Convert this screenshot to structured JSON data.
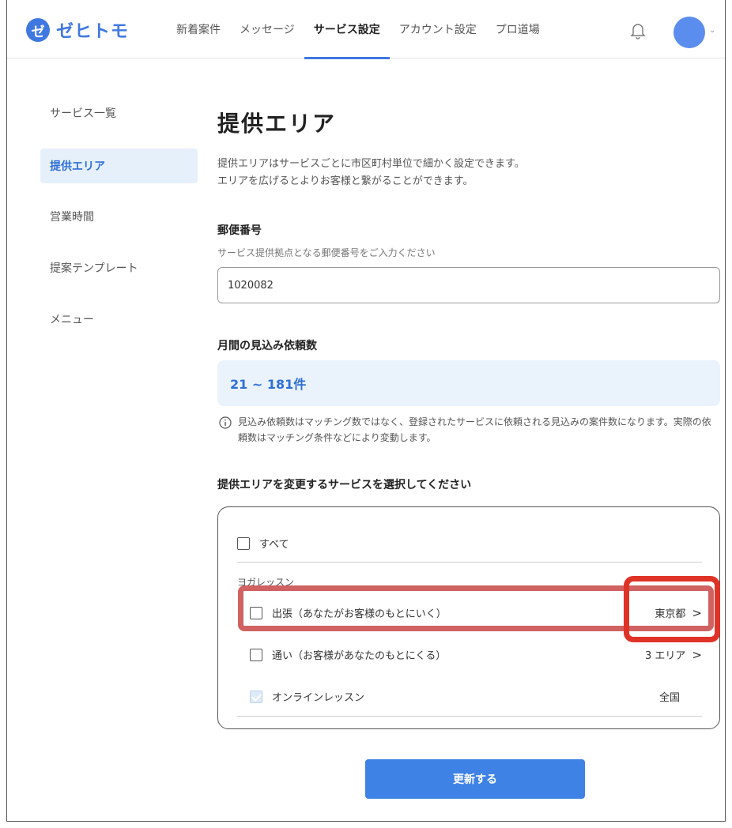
{
  "header": {
    "logo_mark": "ゼ",
    "logo_text": "ゼヒトモ",
    "nav": [
      "新着案件",
      "メッセージ",
      "サービス設定",
      "アカウント設定",
      "プロ道場"
    ],
    "active_nav": "サービス設定",
    "avatar_caret": "⌄"
  },
  "sidebar": {
    "items": [
      "サービス一覧",
      "提供エリア",
      "営業時間",
      "提案テンプレート",
      "メニュー"
    ],
    "active": "提供エリア"
  },
  "main": {
    "title": "提供エリア",
    "description_line1": "提供エリアはサービスごとに市区町村単位で細かく設定できます。",
    "description_line2": "エリアを広げるとよりお客様と繋がることができます。",
    "postal": {
      "label": "郵便番号",
      "hint": "サービス提供拠点となる郵便番号をご入力ください",
      "value": "1020082"
    },
    "estimate": {
      "label": "月間の見込み依頼数",
      "value": "21 ~ 181件",
      "note": "見込み依頼数はマッチング数ではなく、登録されたサービスに依頼される見込みの案件数になります。実際の依頼数はマッチング条件などにより変動します。"
    },
    "services": {
      "label": "提供エリアを変更するサービスを選択してください",
      "all_label": "すべて",
      "group": "ヨガレッスン",
      "rows": [
        {
          "label": "出張（あなたがお客様のもとにいく）",
          "area": "東京都",
          "chevron": ">",
          "checked": false
        },
        {
          "label": "通い（お客様があなたのもとにくる）",
          "area": "3 エリア",
          "chevron": ">",
          "checked": false
        },
        {
          "label": "オンラインレッスン",
          "area": "全国",
          "chevron": "",
          "checked": true
        }
      ]
    },
    "submit_label": "更新する"
  },
  "colors": {
    "accent": "#3f78e0",
    "highlight_row": "#c84646",
    "highlight_area": "#e03327"
  }
}
